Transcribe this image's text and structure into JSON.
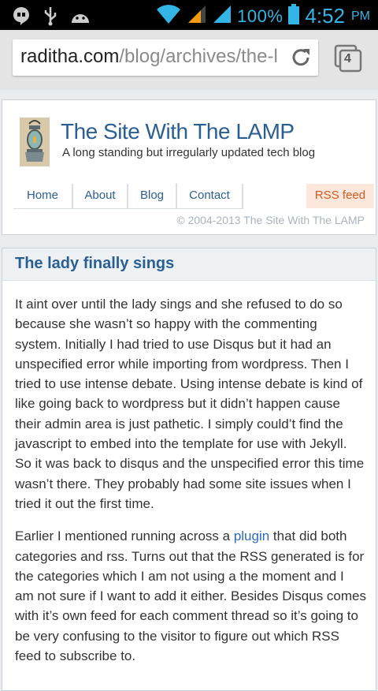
{
  "status_bar": {
    "battery_pct": "100%",
    "time": "4:52",
    "ampm": "PM",
    "icons": [
      "hangouts-icon",
      "usb-icon",
      "android-icon",
      "wifi-icon",
      "signal-icon",
      "signal-icon",
      "battery-icon"
    ]
  },
  "browser": {
    "url_domain": "raditha.com",
    "url_path": "/blog/archives/the-l",
    "tab_count": "4"
  },
  "site": {
    "title": "The Site With The LAMP",
    "tagline": "A long standing but irregularly updated tech blog",
    "nav": [
      "Home",
      "About",
      "Blog",
      "Contact"
    ],
    "rss": "RSS feed",
    "copyright": "© 2004-2013 The Site With The LAMP"
  },
  "article": {
    "title": "The lady finally sings",
    "p1": "It aint over until the lady sings and she refused to do so because she wasn’t so happy with the commenting system. Initially I had tried to use Disqus but it had an unspecified error while importing from wordpress. Then I tried to use intense debate. Using intense debate is kind of like going back to wordpress but it didn’t happen cause their admin area is just pathetic. I simply could’t find the javascript to embed into the template for use with Jekyll.  So it was back to disqus and the unspecified error this time wasn’t there.  They probably had some site issues when I tried it out the first time.",
    "p2_before": "Earlier I mentioned running across a ",
    "p2_link": "plugin",
    "p2_after": " that did both categories and rss. Turns out that the RSS generated is for the  categories which I am not using a the moment and I am not sure if I want to add it either.  Besides Disqus comes with it’s own feed for each comment thread so it’s going to be very confusing to the visitor to figure out which RSS feed to subscribe to."
  },
  "colors": {
    "accent": "#33b5e5",
    "link": "#2a5f94",
    "rss": "#d45a1e"
  }
}
